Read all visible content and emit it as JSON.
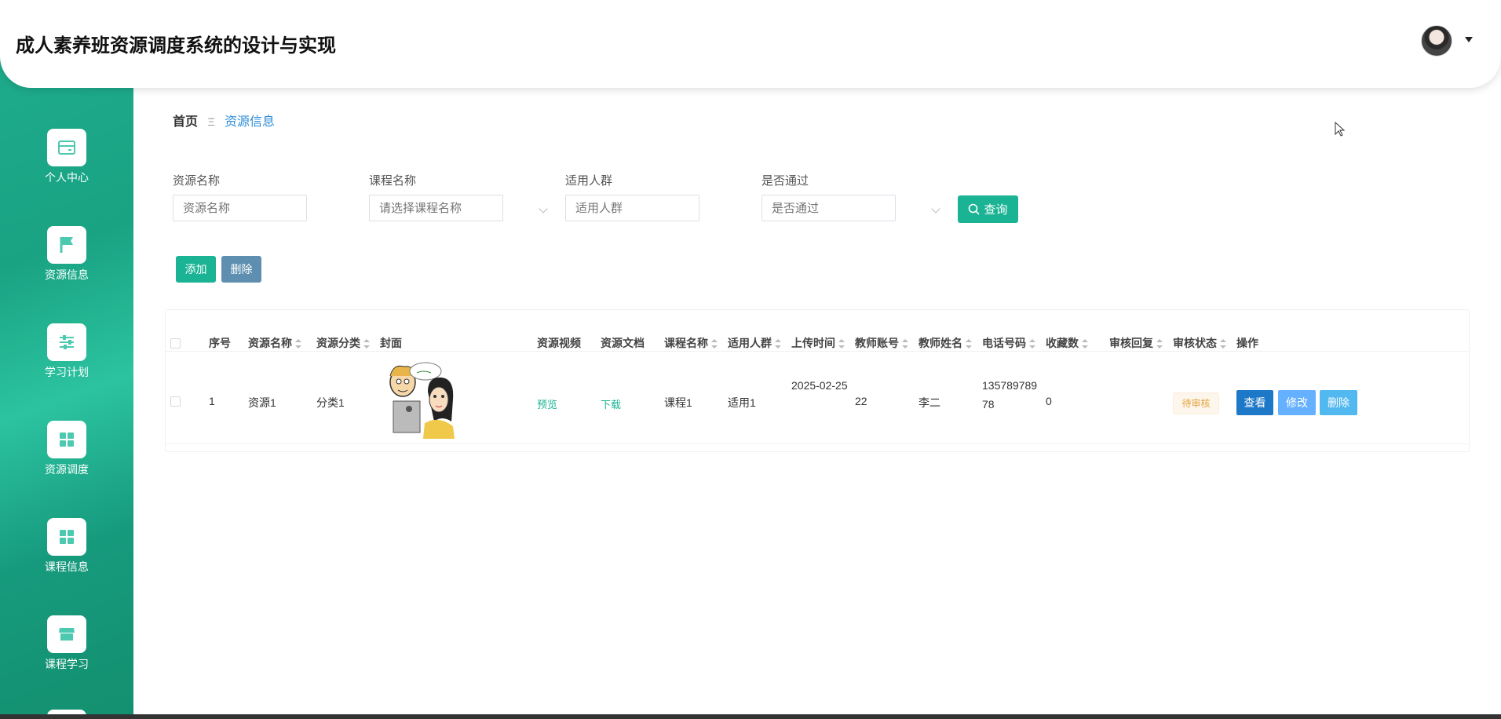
{
  "header": {
    "title": "成人素养班资源调度系统的设计与实现"
  },
  "sidebar": {
    "items": [
      {
        "label": "个人中心",
        "icon": "card-icon"
      },
      {
        "label": "资源信息",
        "icon": "flag-icon"
      },
      {
        "label": "学习计划",
        "icon": "sliders-icon"
      },
      {
        "label": "资源调度",
        "icon": "grid-icon"
      },
      {
        "label": "课程信息",
        "icon": "grid-icon"
      },
      {
        "label": "课程学习",
        "icon": "store-icon"
      }
    ]
  },
  "breadcrumb": {
    "home": "首页",
    "separator": "Ξ",
    "current": "资源信息"
  },
  "filters": {
    "resource_name": {
      "label": "资源名称",
      "placeholder": "资源名称"
    },
    "course_name": {
      "label": "课程名称",
      "placeholder": "请选择课程名称"
    },
    "audience": {
      "label": "适用人群",
      "placeholder": "适用人群"
    },
    "approved": {
      "label": "是否通过",
      "placeholder": "是否通过"
    },
    "query_label": "查询"
  },
  "actions": {
    "add_label": "添加",
    "delete_label": "删除"
  },
  "table": {
    "headers": {
      "index": "序号",
      "resource_name": "资源名称",
      "category": "资源分类",
      "cover": "封面",
      "video": "资源视频",
      "document": "资源文档",
      "course_name": "课程名称",
      "audience": "适用人群",
      "upload_time": "上传时间",
      "teacher_account": "教师账号",
      "teacher_name": "教师姓名",
      "phone": "电话号码",
      "favorites": "收藏数",
      "review_reply": "审核回复",
      "review_status": "审核状态",
      "operations": "操作"
    },
    "rows": [
      {
        "index": "1",
        "resource_name": "资源1",
        "category": "分类1",
        "video": "预览",
        "document": "下载",
        "course_name": "课程1",
        "audience": "适用1",
        "upload_time": "2025-02-25",
        "teacher_account": "22",
        "teacher_name": "李二",
        "phone": "13578978978",
        "favorites": "0",
        "review_reply": "",
        "review_status": "待审核",
        "view_label": "查看",
        "edit_label": "修改",
        "delete_label": "删除"
      }
    ]
  },
  "colors": {
    "sidebar": "#1fae8f",
    "primary": "#1ab394",
    "view_button": "#1e78c8",
    "edit_button": "#66b1ff",
    "delete_button": "#52b8f0",
    "pending_badge": "#e6a23c"
  }
}
